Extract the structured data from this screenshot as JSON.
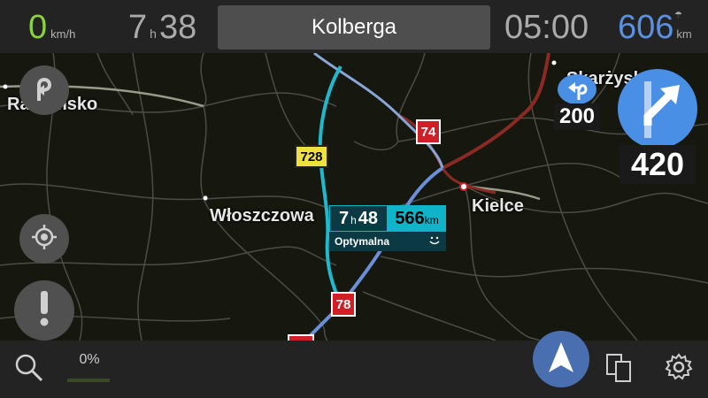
{
  "topbar": {
    "speed_value": "0",
    "speed_unit": "km/h",
    "eta_hours": "7",
    "eta_h_label": "h",
    "eta_minutes": "38",
    "street_name": "Kolberga",
    "clock": "05:00",
    "distance_value": "606",
    "distance_unit": "km"
  },
  "map": {
    "cities": [
      "Radomsko",
      "Włoszczowa",
      "Kielce",
      "Skarżysko"
    ],
    "road_shields": {
      "red_74": "74",
      "red_78": "78",
      "yellow_728": "728"
    }
  },
  "route_label": {
    "hours": "7",
    "h_label": "h",
    "minutes": "48",
    "km_value": "566",
    "km_unit": "km",
    "route_type": "Optymalna"
  },
  "turns": {
    "next_turn_distance": "200",
    "main_turn_distance": "420"
  },
  "bottombar": {
    "progress_text": "0%",
    "progress_fraction": 0.0
  },
  "colors": {
    "speed_green": "#8cd23c",
    "distance_blue": "#5b8fe0",
    "route_cyan": "#0fb4c8",
    "turn_blue": "#4a8fe6",
    "road_red": "#cf2027"
  },
  "icons": [
    "u-turn-icon",
    "locate-icon",
    "alert-icon",
    "search-icon",
    "navigation-arrow-icon",
    "layers-icon",
    "settings-gear-icon",
    "umbrella-icon",
    "smiley-icon"
  ]
}
